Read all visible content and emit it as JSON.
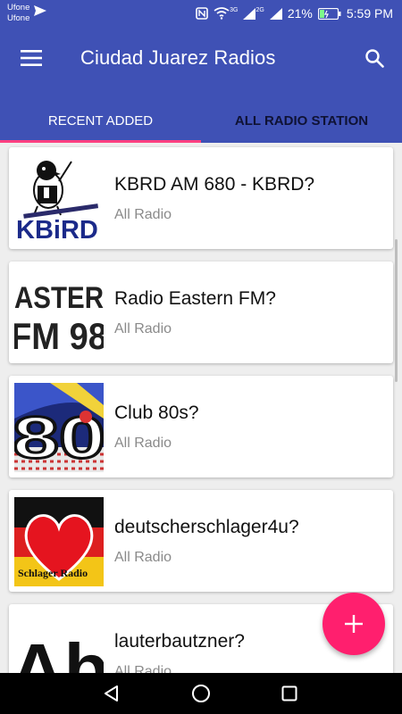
{
  "status_bar": {
    "carrier_1": "Ufone",
    "carrier_2": "Ufone",
    "battery": "21%",
    "time": "5:59 PM",
    "network_1": "3G",
    "network_2": "2G"
  },
  "app_bar": {
    "title": "Ciudad Juarez Radios",
    "color": "#3F51B5",
    "menu_icon": "hamburger-menu-icon",
    "search_icon": "search-icon"
  },
  "tabs": [
    {
      "label": "RECENT ADDED",
      "active": true
    },
    {
      "label": "ALL RADIO STATION",
      "active": false
    }
  ],
  "accent_color": "#FF4081",
  "stations": [
    {
      "name": "KBRD AM 680 - KBRD?",
      "category": "All Radio",
      "logo_text": "KBiRD"
    },
    {
      "name": "Radio Eastern FM?",
      "category": "All Radio",
      "logo_text": "ASTER FM 98"
    },
    {
      "name": "Club 80s?",
      "category": "All Radio",
      "logo_text": "80"
    },
    {
      "name": "deutscherschlager4u?",
      "category": "All Radio",
      "logo_text": "Schlager Radio"
    },
    {
      "name": "lauterbautzner?",
      "category": "All Radio",
      "logo_text": "Ab"
    }
  ],
  "fab": {
    "icon": "plus-icon",
    "color": "#FF1F6E"
  },
  "nav": {
    "back_icon": "back-icon",
    "home_icon": "home-icon",
    "recents_icon": "recents-icon"
  }
}
